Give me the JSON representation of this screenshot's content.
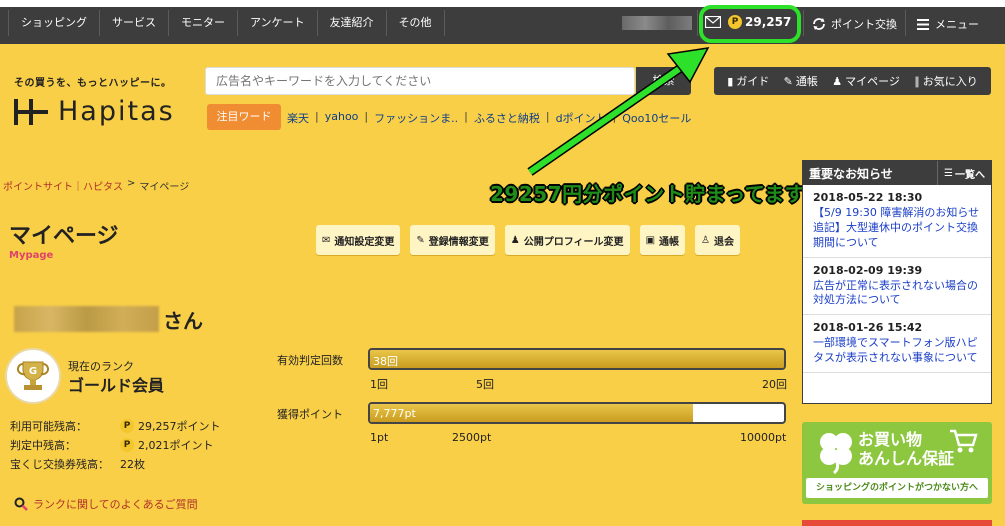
{
  "topnav": {
    "items": [
      "ショッピング",
      "サービス",
      "モニター",
      "アンケート",
      "友達紹介",
      "その他"
    ],
    "points": "29,257",
    "point_coin": "P",
    "exchange_label": "ポイント交換",
    "menu_label": "メニュー"
  },
  "header": {
    "tagline": "その買うを、もっとハッピーに。",
    "logo": "Hapitas",
    "search_placeholder": "広告名やキーワードを入力してください",
    "search_button": "検索",
    "hot_label": "注目ワード",
    "hot_words": [
      "楽天",
      "yahoo",
      "ファッションま..",
      "ふるさと納税",
      "dポイント",
      "Qoo10セール"
    ],
    "util": [
      "ガイド",
      "通帳",
      "マイページ",
      "お気に入り"
    ]
  },
  "breadcrumb": {
    "items": [
      "ポイントサイト｜ハピタス",
      "マイページ"
    ],
    "separator": ">"
  },
  "page": {
    "title": "マイページ",
    "subtitle": "Mypage",
    "actions": [
      "通知設定変更",
      "登録情報変更",
      "公開プロフィール変更",
      "通帳",
      "退会"
    ]
  },
  "user": {
    "honorific": "さん",
    "rank_caption": "現在のランク",
    "rank_value": "ゴールド会員",
    "balances": [
      {
        "label": "利用可能残高：",
        "value": "29,257ポイント",
        "coin": true
      },
      {
        "label": "判定中残高：",
        "value": "2,021ポイント",
        "coin": true
      },
      {
        "label": "宝くじ交換券残高：",
        "value": "22枚",
        "coin": false
      }
    ],
    "faq_link": "ランクに関してのよくあるご質問"
  },
  "progress": {
    "count": {
      "label": "有効判定回数",
      "value_text": "38回",
      "fill_ratio": 1.0,
      "ticks": [
        "1回",
        "5回",
        "20回"
      ]
    },
    "points": {
      "label": "獲得ポイント",
      "value_text": "7,777pt",
      "fill_ratio": 0.78,
      "ticks": [
        "1pt",
        "2500pt",
        "10000pt"
      ]
    }
  },
  "annotation": "29257円分ポイント貯まってます！！",
  "news": {
    "title": "重要なお知らせ",
    "list_button": "一覧へ",
    "items": [
      {
        "date": "2018-05-22 18:30",
        "text": "【5/9 19:30 障害解消のお知らせ追記】大型連休中のポイント交換期間について"
      },
      {
        "date": "2018-02-09 19:39",
        "text": "広告が正常に表示されない場合の対処方法について"
      },
      {
        "date": "2018-01-26 15:42",
        "text": "一部環境でスマートフォン版ハピタスが表示されない事象について"
      }
    ]
  },
  "banner": {
    "title_line1": "お買い物",
    "title_line2": "あんしん保証",
    "footer": "ショッピングのポイントがつかない方へ"
  },
  "colors": {
    "background": "#f9cf47",
    "dark": "#3d3d3d",
    "highlight_green": "#2de02a",
    "link_blue": "#1a3ec7",
    "accent_orange": "#f08c32"
  }
}
